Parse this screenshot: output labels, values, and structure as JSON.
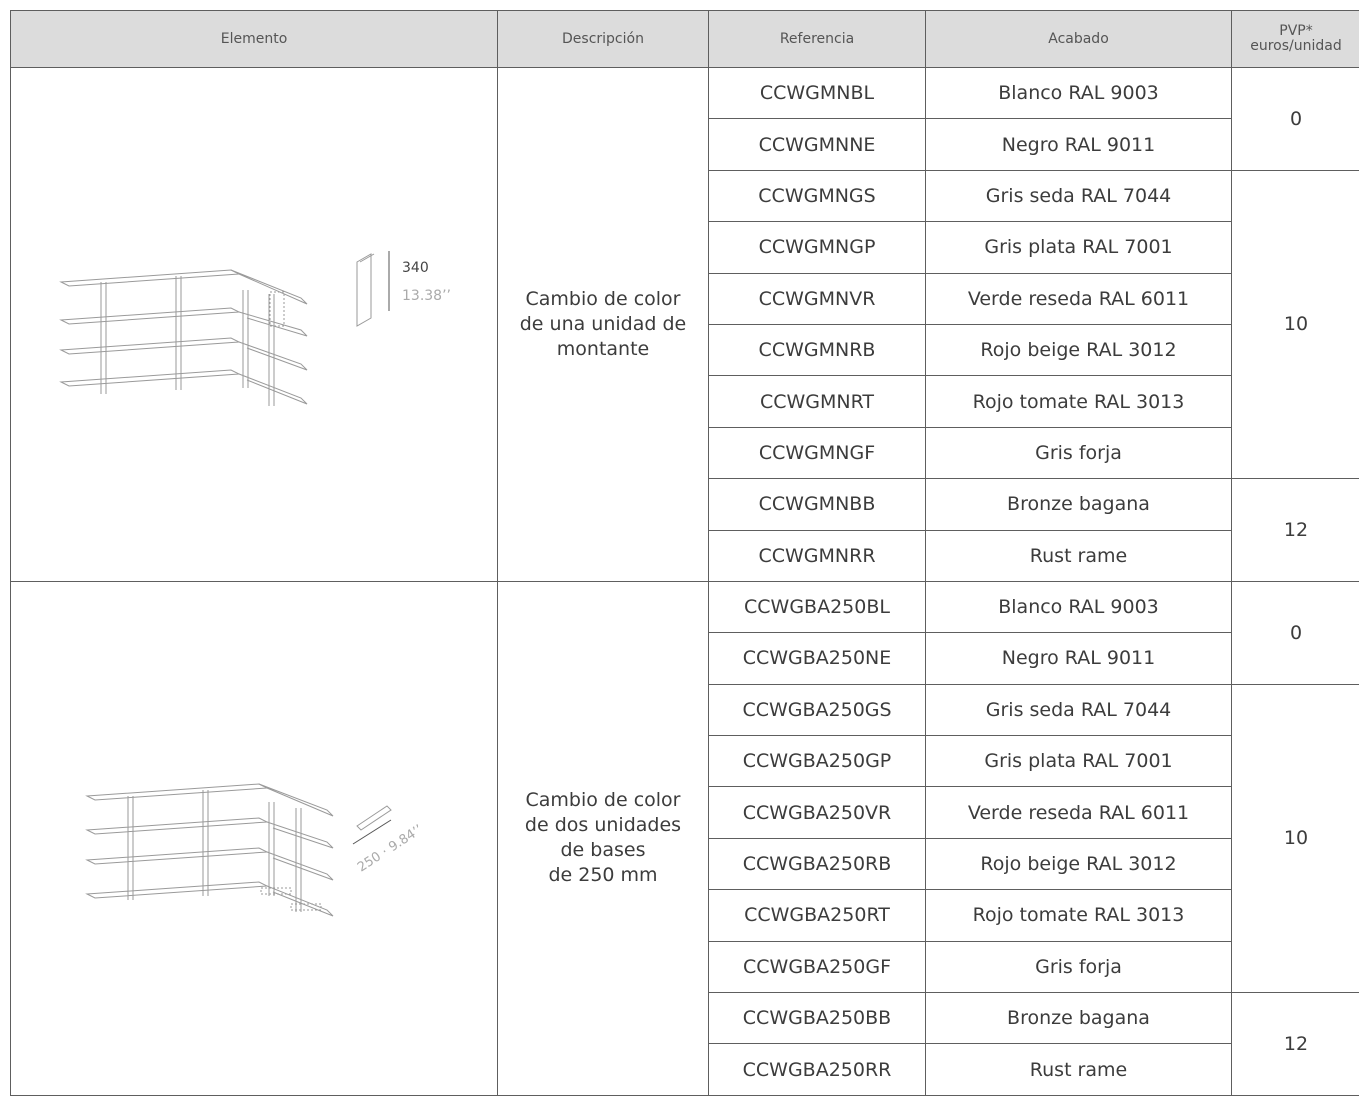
{
  "headers": {
    "elemento": "Elemento",
    "descripcion": "Descripción",
    "referencia": "Referencia",
    "acabado": "Acabado",
    "pvp": "PVP*",
    "pvp_unit": "euros/unidad"
  },
  "sections": [
    {
      "description": [
        "Cambio de color",
        "de una unidad de",
        "montante"
      ],
      "dimension_main": "340",
      "dimension_alt": "13.38’’",
      "rows": [
        {
          "ref": "CCWGMNBL",
          "finish": "Blanco RAL 9003"
        },
        {
          "ref": "CCWGMNNE",
          "finish": "Negro RAL 9011"
        },
        {
          "ref": "CCWGMNGS",
          "finish": "Gris seda RAL 7044"
        },
        {
          "ref": "CCWGMNGP",
          "finish": "Gris plata RAL 7001"
        },
        {
          "ref": "CCWGMNVR",
          "finish": "Verde reseda RAL 6011"
        },
        {
          "ref": "CCWGMNRB",
          "finish": "Rojo beige RAL 3012"
        },
        {
          "ref": "CCWGMNRT",
          "finish": "Rojo tomate RAL 3013"
        },
        {
          "ref": "CCWGMNGF",
          "finish": "Gris forja"
        },
        {
          "ref": "CCWGMNBB",
          "finish": "Bronze bagana"
        },
        {
          "ref": "CCWGMNRR",
          "finish": "Rust rame"
        }
      ],
      "prices": [
        "0",
        "10",
        "12"
      ]
    },
    {
      "description": [
        "Cambio de color",
        "de dos unidades",
        "de bases",
        "de 250 mm"
      ],
      "dimension_label": "250 · 9.84’’",
      "rows": [
        {
          "ref": "CCWGBA250BL",
          "finish": "Blanco RAL 9003"
        },
        {
          "ref": "CCWGBA250NE",
          "finish": "Negro RAL 9011"
        },
        {
          "ref": "CCWGBA250GS",
          "finish": "Gris seda RAL 7044"
        },
        {
          "ref": "CCWGBA250GP",
          "finish": "Gris plata RAL 7001"
        },
        {
          "ref": "CCWGBA250VR",
          "finish": "Verde reseda RAL 6011"
        },
        {
          "ref": "CCWGBA250RB",
          "finish": "Rojo beige RAL 3012"
        },
        {
          "ref": "CCWGBA250RT",
          "finish": "Rojo tomate RAL 3013"
        },
        {
          "ref": "CCWGBA250GF",
          "finish": "Gris forja"
        },
        {
          "ref": "CCWGBA250BB",
          "finish": "Bronze bagana"
        },
        {
          "ref": "CCWGBA250RR",
          "finish": "Rust rame"
        }
      ],
      "prices": [
        "0",
        "10",
        "12"
      ]
    }
  ]
}
